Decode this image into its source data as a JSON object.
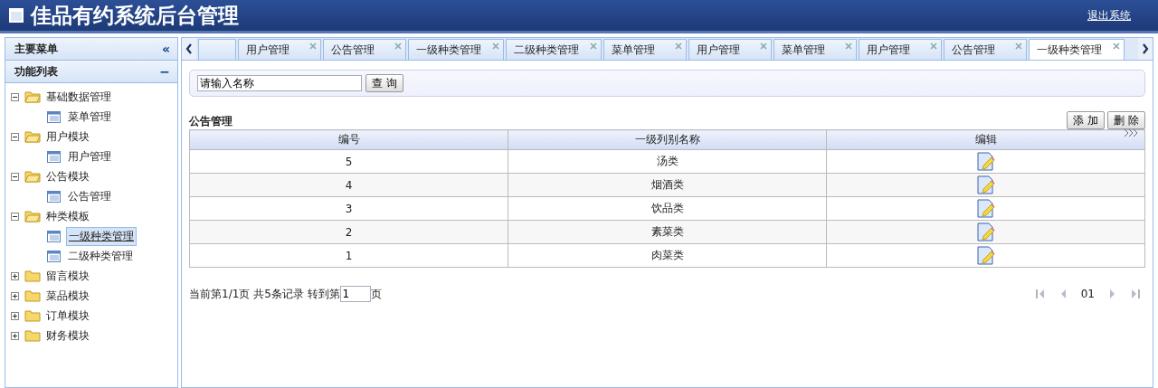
{
  "header": {
    "title": "佳品有约系统后台管理",
    "logout": "退出系统"
  },
  "sidebar": {
    "title": "主要菜单",
    "collapse": "«",
    "section": "功能列表",
    "section_toggle": "−",
    "tree": [
      {
        "label": "基础数据管理",
        "expanded": true,
        "children": [
          {
            "label": "菜单管理",
            "selected": false
          }
        ]
      },
      {
        "label": "用户模块",
        "expanded": true,
        "children": [
          {
            "label": "用户管理",
            "selected": false
          }
        ]
      },
      {
        "label": "公告模块",
        "expanded": true,
        "children": [
          {
            "label": "公告管理",
            "selected": false
          }
        ]
      },
      {
        "label": "种类模板",
        "expanded": true,
        "children": [
          {
            "label": "一级种类管理",
            "selected": true
          },
          {
            "label": "二级种类管理",
            "selected": false
          }
        ]
      },
      {
        "label": "留言模块",
        "expanded": false
      },
      {
        "label": "菜品模块",
        "expanded": false
      },
      {
        "label": "订单模块",
        "expanded": false
      },
      {
        "label": "财务模块",
        "expanded": false
      }
    ]
  },
  "tabs": [
    {
      "label": "用户管理",
      "selected": false
    },
    {
      "label": "公告管理",
      "selected": false
    },
    {
      "label": "一级种类管理",
      "selected": false
    },
    {
      "label": "二级种类管理",
      "selected": false
    },
    {
      "label": "菜单管理",
      "selected": false
    },
    {
      "label": "用户管理",
      "selected": false
    },
    {
      "label": "菜单管理",
      "selected": false
    },
    {
      "label": "用户管理",
      "selected": false
    },
    {
      "label": "公告管理",
      "selected": false
    },
    {
      "label": "一级种类管理",
      "selected": true
    }
  ],
  "search": {
    "value": "请输入名称",
    "button": "查 询"
  },
  "panel_title": "公告管理",
  "actions": [
    "添 加",
    "删 除"
  ],
  "table": {
    "columns": [
      "编号",
      "一级列别名称",
      "编辑"
    ],
    "rows": [
      {
        "id": "5",
        "name": "汤类"
      },
      {
        "id": "4",
        "name": "烟酒类"
      },
      {
        "id": "3",
        "name": "饮品类"
      },
      {
        "id": "2",
        "name": "素菜类"
      },
      {
        "id": "1",
        "name": "肉菜类"
      }
    ]
  },
  "pager": {
    "info": "当前第1/1页 共5条记录 转到第",
    "page_input": "1",
    "suffix": "页",
    "current": "01"
  }
}
